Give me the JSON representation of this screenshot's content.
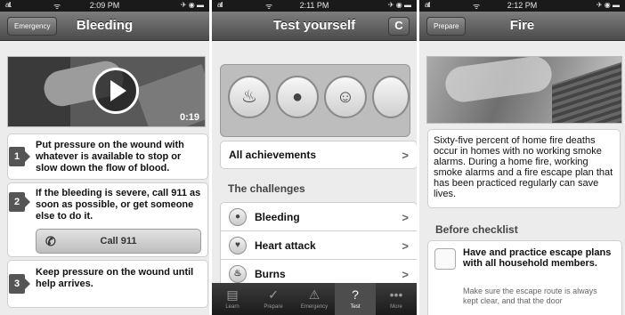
{
  "screens": [
    {
      "status": {
        "signal": "atl.",
        "wifi": "ᯤ",
        "time": "2:09 PM",
        "battery": "✈ ◉ ▬"
      },
      "nav": {
        "back_label": "Emergency",
        "title": "Bleeding"
      },
      "video": {
        "duration": "0:19"
      },
      "steps": [
        {
          "num": "1",
          "text": "Put pressure on the wound with whatever is available to stop or slow down the flow of blood."
        },
        {
          "num": "2",
          "text": "If the bleeding is severe, call 911 as soon as possible, or get someone else to do it."
        },
        {
          "num": "3",
          "text": "Keep pressure on the wound until help arrives."
        }
      ],
      "call_button": "Call 911"
    },
    {
      "status": {
        "signal": "atl",
        "wifi": "ᯤ",
        "time": "2:11 PM",
        "battery": "✈ ◉ ▬"
      },
      "nav": {
        "title": "Test yourself",
        "refresh_icon": "C"
      },
      "all_achievements": "All achievements",
      "section": "The challenges",
      "challenges": [
        {
          "label": "Bleeding",
          "icon": "blood-drop-icon",
          "glyph": "●"
        },
        {
          "label": "Heart attack",
          "icon": "heart-icon",
          "glyph": "♥"
        },
        {
          "label": "Burns",
          "icon": "flame-icon",
          "glyph": "♨"
        }
      ],
      "chevron": ">",
      "tabs": [
        {
          "label": "Learn",
          "glyph": "▤"
        },
        {
          "label": "Prepare",
          "glyph": "✓"
        },
        {
          "label": "Emergency",
          "glyph": "⚠"
        },
        {
          "label": "Test",
          "glyph": "?"
        },
        {
          "label": "More",
          "glyph": "•••"
        }
      ],
      "active_tab": "Test"
    },
    {
      "status": {
        "signal": "atl",
        "wifi": "ᯤ",
        "time": "2:12 PM",
        "battery": "✈ ◉ ▬"
      },
      "nav": {
        "back_label": "Prepare",
        "title": "Fire"
      },
      "description": "Sixty-five percent of home fire deaths occur in homes with no working smoke alarms. During a home fire, working smoke alarms and a fire escape plan that has been practiced regularly can save lives.",
      "section": "Before checklist",
      "checklist_item": {
        "title": "Have and practice escape plans with all household members.",
        "body": "Make sure the escape route is always kept clear, and that the door"
      }
    }
  ],
  "colors": {
    "accent": "#555555",
    "navbar": "#5e5e5e"
  }
}
